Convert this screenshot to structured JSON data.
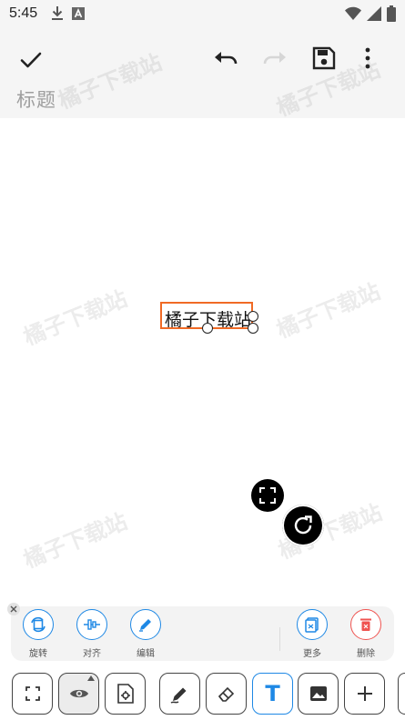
{
  "status_bar": {
    "time": "5:45",
    "icons": [
      "download-icon",
      "font-a-icon",
      "wifi-icon",
      "signal-icon",
      "battery-icon"
    ]
  },
  "toolbar": {
    "title": "标题",
    "icons": [
      "check-icon",
      "undo-icon",
      "redo-icon",
      "save-icon",
      "more-vert-icon"
    ]
  },
  "canvas": {
    "text_object": "橘子下载站",
    "watermark": "橘子下载站"
  },
  "edit_panel": {
    "actions": [
      {
        "label": "旋转",
        "icon": "rotate-icon"
      },
      {
        "label": "对齐",
        "icon": "align-icon"
      },
      {
        "label": "编辑",
        "icon": "pencil-icon"
      },
      {
        "label": "更多",
        "icon": "more-icon"
      },
      {
        "label": "删除",
        "icon": "delete-icon"
      }
    ]
  },
  "bottom_tools": {
    "text_tool_label": "T",
    "icons": [
      "fullscreen-icon",
      "eye-icon",
      "settings-file-icon",
      "pen-icon",
      "eraser-icon",
      "text-icon",
      "image-icon",
      "plus-icon"
    ]
  },
  "colors": {
    "accent": "#1e88e5",
    "selection": "#f06a25",
    "danger": "#ef5350"
  }
}
